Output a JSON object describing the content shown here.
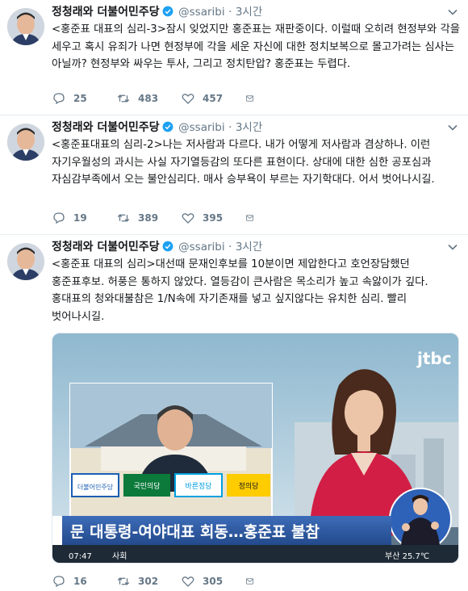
{
  "tweets": [
    {
      "author": "정청래와 더불어민주당",
      "handle": "@ssaribi",
      "separator": "·",
      "time": "3시간",
      "text": "<홍준표 대표의 심리-3>잠시 잊었지만 홍준표는 재판중이다. 이럴때 오히려 현정부와 각을 세우고 혹시 유죄가 나면 현정부에 각을 세운 자신에 대한 정치보복으로 몰고가려는 심사는 아닐까? 현정부와 싸우는 투사, 그리고 정치탄압? 홍준표는 두렵다.",
      "replies": "25",
      "retweets": "483",
      "likes": "457"
    },
    {
      "author": "정청래와 더불어민주당",
      "handle": "@ssaribi",
      "separator": "·",
      "time": "3시간",
      "text": "<홍준표대표의 심리-2>나는 저사람과 다르다. 내가 어떻게 저사람과 겸상하나. 이런 자기우월성의 과시는 사실 자기열등감의 또다른 표현이다. 상대에 대한 심한 공포심과 자심감부족에서 오는 불안심리다. 매사 승부욕이 부르는 자기학대다. 어서 벗어나시길.",
      "replies": "19",
      "retweets": "389",
      "likes": "395"
    },
    {
      "author": "정청래와 더불어민주당",
      "handle": "@ssaribi",
      "separator": "·",
      "time": "3시간",
      "text": "<홍준표 대표의 심리>대선때 문재인후보를 10분이면 제압한다고 호언장담했던 홍준표후보. 허풍은 통하지 않았다. 열등감이 큰사람은 목소리가 높고 속앓이가 깊다. 홍대표의 청와대불참은 1/N속에 자기존재를 넣고 싶지않다는 유치한 심리. 빨리 벗어나시길.",
      "replies": "16",
      "retweets": "302",
      "likes": "305"
    }
  ],
  "media": {
    "channel_logo": "jtbc",
    "headline": "문 대통령-여야대표 회동…홍준표 불참",
    "clock": "07:47",
    "section": "사회",
    "weather": "부산 25.7℃",
    "party_labels": [
      "더불어민주당",
      "국민의당",
      "바른정당",
      "정의당"
    ]
  },
  "colors": {
    "verified": "#1da1f2",
    "muted": "#657786",
    "headline_bar": "#2d5aa5"
  }
}
